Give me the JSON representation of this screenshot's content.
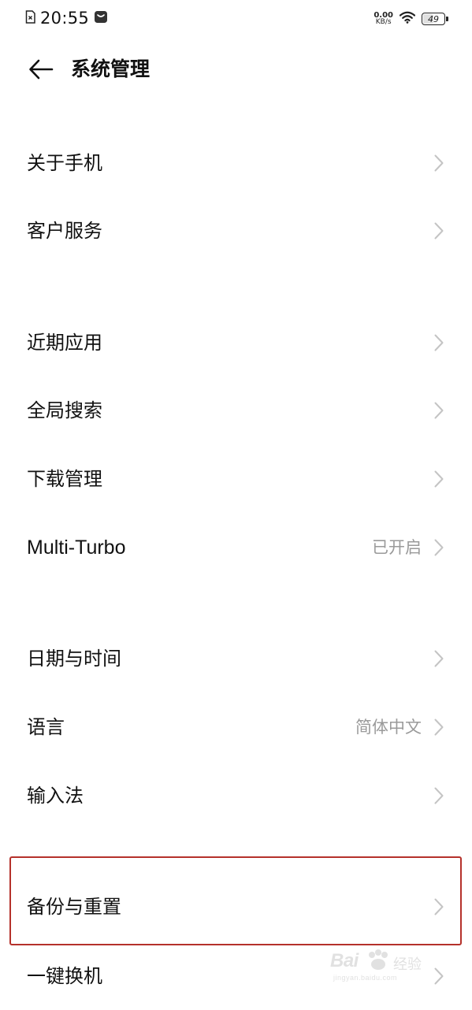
{
  "status_bar": {
    "time": "20:55",
    "net_speed_value": "0.00",
    "net_speed_unit": "KB/s",
    "battery_level": "49",
    "battery_fraction": 0.49
  },
  "header": {
    "title": "系统管理"
  },
  "menu": {
    "about_phone": "关于手机",
    "customer_service": "客户服务",
    "recent_apps": "近期应用",
    "global_search": "全局搜索",
    "download_manager": "下载管理",
    "multi_turbo": "Multi-Turbo",
    "multi_turbo_value": "已开启",
    "date_time": "日期与时间",
    "language": "语言",
    "language_value": "简体中文",
    "input_method": "输入法",
    "backup_reset": "备份与重置",
    "phone_clone": "一键换机"
  },
  "watermark": {
    "brand": "Bai",
    "brand_tail": "经验",
    "site": "jingyan.baidu.com"
  },
  "colors": {
    "highlight_border": "#b5312b",
    "secondary_text": "#9a9a9a",
    "chevron": "#c4c4c4"
  }
}
